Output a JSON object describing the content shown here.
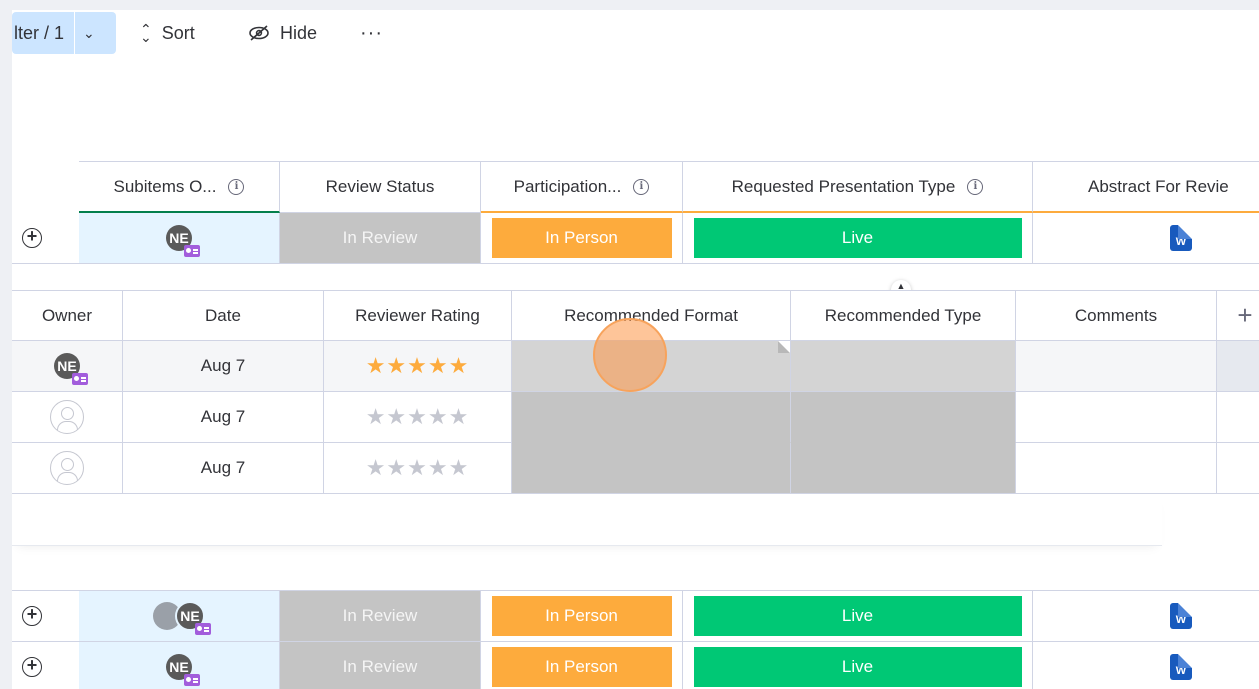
{
  "toolbar": {
    "filter_label": "lter / 1",
    "sort_label": "Sort",
    "hide_label": "Hide",
    "more_label": "···"
  },
  "main_table": {
    "columns": [
      "Subitems O...",
      "Review Status",
      "Participation...",
      "Requested Presentation Type",
      "Abstract For Revie"
    ],
    "rows": [
      {
        "avatar": "NE",
        "status": "In Review",
        "participation": "In Person",
        "presentation_type": "Live",
        "file": "W"
      },
      {
        "avatar": "NE",
        "status": "In Review",
        "participation": "In Person",
        "presentation_type": "Live",
        "file": "W"
      },
      {
        "avatar": "NE",
        "status": "In Review",
        "participation": "In Person",
        "presentation_type": "Live",
        "file": "W"
      }
    ]
  },
  "subitems_table": {
    "columns": [
      "Owner",
      "Date",
      "Reviewer Rating",
      "Recommended Format",
      "Recommended Type",
      "Comments"
    ],
    "add_column": "+",
    "rows": [
      {
        "owner": "NE",
        "date": "Aug 7",
        "rating": 5,
        "rating_stars": "★★★★★"
      },
      {
        "owner": "",
        "date": "Aug 7",
        "rating": 0,
        "rating_stars": "★★★★★"
      },
      {
        "owner": "",
        "date": "Aug 7",
        "rating": 0,
        "rating_stars": "★★★★★"
      }
    ]
  },
  "colors": {
    "status_grey": "#c4c4c4",
    "in_person_orange": "#fdab3d",
    "live_green": "#00c875",
    "star_active": "#fdab3d",
    "star_inactive": "#c5c7d0",
    "selection_blue": "#e5f4ff",
    "word_blue": "#185abd"
  }
}
